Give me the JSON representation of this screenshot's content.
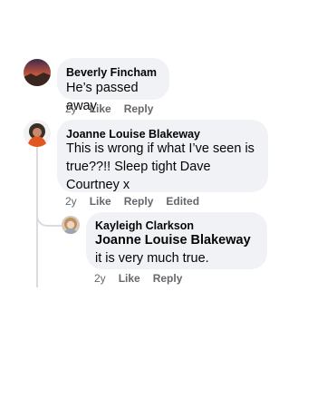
{
  "comments": [
    {
      "author": "Beverly Fincham",
      "text": "He’s passed away",
      "meta": {
        "time": "2y",
        "like": "Like",
        "reply": "Reply"
      }
    },
    {
      "author": "Joanne Louise Blakeway",
      "text": "This is wrong if what I’ve seen is true??!! Sleep tight Dave Courtney x",
      "meta": {
        "time": "2y",
        "like": "Like",
        "reply": "Reply",
        "edited": "Edited"
      }
    },
    {
      "author": "Kayleigh Clarkson",
      "mention": "Joanne Louise Blakeway",
      "text": " it is very much true.",
      "meta": {
        "time": "2y",
        "like": "Like",
        "reply": "Reply"
      }
    }
  ]
}
